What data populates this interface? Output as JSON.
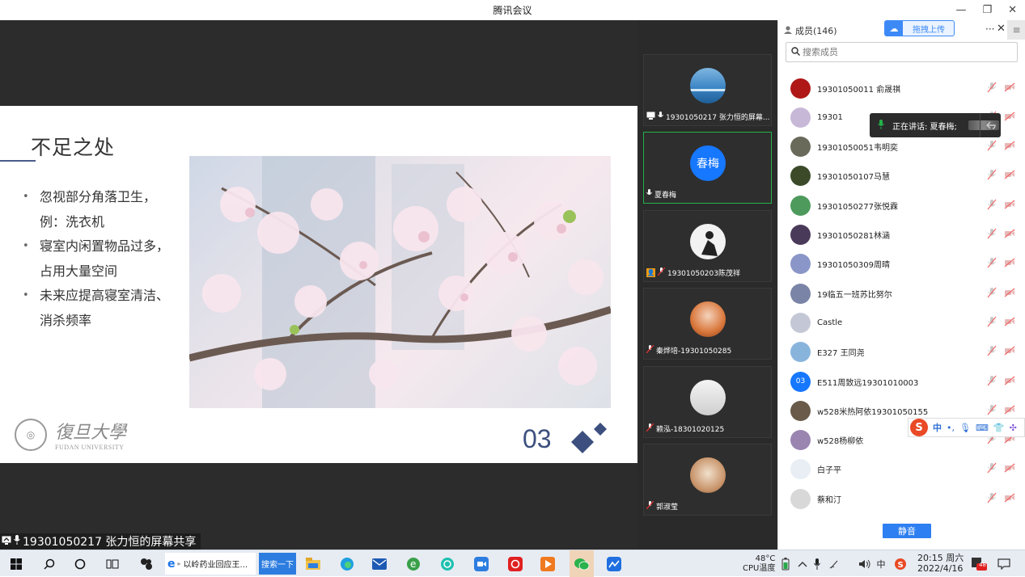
{
  "window": {
    "title": "腾讯会议",
    "minimize": "—",
    "maximize": "❐",
    "close": "✕"
  },
  "slide": {
    "title": "不足之处",
    "bullets": [
      "忽视部分角落卫生，例：洗衣机",
      "寝室内闲置物品过多，占用大量空间",
      "未来应提高寝室清洁、消杀频率"
    ],
    "logo_text_cn": "復旦大學",
    "logo_text_en": "FUDAN UNIVERSITY",
    "page_number": "03"
  },
  "share_label": "19301050217 张力恒的屏幕共享",
  "video_tiles": [
    {
      "name": "19301050217 张力恒的屏幕...",
      "avatar": "landscape",
      "color": "#3d86c6"
    },
    {
      "name": "夏春梅",
      "avatar_text": "春梅",
      "color": "#1677ff",
      "active": true
    },
    {
      "name": "19301050203陈茂祥",
      "avatar": "silhouette",
      "color": "#dddddd"
    },
    {
      "name": "秦烨培-19301050285",
      "avatar": "anime",
      "color": "#d9773b"
    },
    {
      "name": "赖泓-18301020125",
      "avatar": "photo",
      "color": "#e6e6e6"
    },
    {
      "name": "郭淑莹",
      "avatar": "cat",
      "color": "#c79268"
    }
  ],
  "members_panel": {
    "title": "成员(146)",
    "upload_label": "拖拽上传",
    "more": "···",
    "close": "✕",
    "menu": "≡",
    "search_placeholder": "搜索成员",
    "members": [
      {
        "name": "19301050011 俞晟祺",
        "color": "#b01818"
      },
      {
        "name": "19301",
        "color": "#c8b8d8"
      },
      {
        "name": "19301050051韦明奕",
        "color": "#6a6a5a"
      },
      {
        "name": "19301050107马慧",
        "color": "#3c4a2a"
      },
      {
        "name": "19301050277张悦霖",
        "color": "#4d9a5c"
      },
      {
        "name": "19301050281林涵",
        "color": "#4a3a5a"
      },
      {
        "name": "19301050309周晴",
        "color": "#8a96c8"
      },
      {
        "name": "19临五一班苏比努尔",
        "color": "#7a84a6"
      },
      {
        "name": "Castle",
        "color": "#c4c8d6"
      },
      {
        "name": "E327 王同尧",
        "color": "#88b4dc"
      },
      {
        "name": "E511周致远19301010003",
        "avatar_text": "03",
        "color": "#1677ff"
      },
      {
        "name": "w528米热阿依19301050155",
        "color": "#6a5a4a"
      },
      {
        "name": "w528杨柳依",
        "color": "#9a84b0"
      },
      {
        "name": "白子平",
        "color": "#e8eef4"
      },
      {
        "name": "蔡和汀",
        "color": "#d8d8d8"
      }
    ],
    "speaking_text": "正在讲话: 夏春梅;",
    "mute_button": "静音"
  },
  "ime": {
    "logo": "S",
    "lang": "中",
    "punct": "•,",
    "mic": "🎙",
    "keyboard": "⌨",
    "skin": "👕",
    "tools": "✣"
  },
  "taskbar": {
    "browser_tab": "以岭药业回应王...",
    "search_button": "搜索一下",
    "temperature": "48°C",
    "temperature_label": "CPU温度",
    "ime_lang": "中",
    "time": "20:15 周六",
    "date": "2022/4/16",
    "notification_count": "48"
  },
  "colors": {
    "accent": "#2e7ff1",
    "active_border": "#24b14a",
    "slide_accent": "#3c4f7e"
  }
}
